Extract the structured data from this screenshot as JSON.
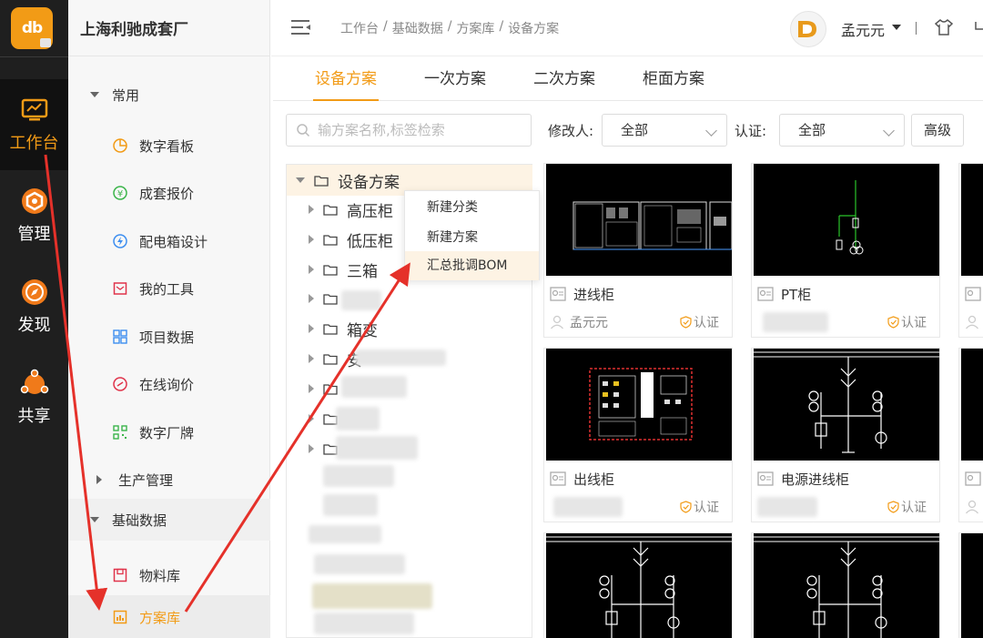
{
  "app": {
    "logo_text": "db",
    "company": "上海利驰成套厂"
  },
  "rail": [
    {
      "label": "工作台",
      "icon": "monitor-icon",
      "active": true
    },
    {
      "label": "管理",
      "icon": "hexagon-gear-icon"
    },
    {
      "label": "发现",
      "icon": "compass-icon"
    },
    {
      "label": "共享",
      "icon": "share-icon"
    }
  ],
  "sidebar": {
    "groups": {
      "common": "常用",
      "production": "生产管理",
      "basic_data": "基础数据"
    },
    "common_items": [
      {
        "label": "数字看板",
        "icon": "pie-chart-icon"
      },
      {
        "label": "成套报价",
        "icon": "yen-icon"
      },
      {
        "label": "配电箱设计",
        "icon": "lightning-icon"
      },
      {
        "label": "我的工具",
        "icon": "toolbox-icon"
      },
      {
        "label": "项目数据",
        "icon": "grid-icon"
      },
      {
        "label": "在线询价",
        "icon": "link-icon"
      },
      {
        "label": "数字厂牌",
        "icon": "qr-icon"
      }
    ],
    "basic_items": [
      {
        "label": "物料库",
        "icon": "box-icon"
      },
      {
        "label": "方案库",
        "icon": "bar-chart-icon",
        "active": true
      }
    ]
  },
  "topbar": {
    "breadcrumb": [
      "工作台",
      "基础数据",
      "方案库",
      "设备方案"
    ],
    "username": "孟元元"
  },
  "tabs": [
    "设备方案",
    "一次方案",
    "二次方案",
    "柜面方案"
  ],
  "filters": {
    "search_placeholder": "输方案名称,标签检索",
    "modifier_label": "修改人:",
    "modifier_value": "全部",
    "cert_label": "认证:",
    "cert_value": "全部",
    "advanced": "高级"
  },
  "tree": {
    "root": "设备方案",
    "children": [
      "高压柜",
      "低压柜",
      "三箱",
      "",
      "箱变",
      "安"
    ]
  },
  "context_menu": [
    "新建分类",
    "新建方案",
    "汇总批调BOM"
  ],
  "cards": [
    {
      "name": "进线柜",
      "user": "孟元元",
      "cert": "认证"
    },
    {
      "name": "PT柜",
      "user": "",
      "cert": "认证"
    },
    {
      "name": "出线柜",
      "user": "",
      "cert": "认证"
    },
    {
      "name": "电源进线柜",
      "user": "",
      "cert": "认证"
    },
    {
      "name": "",
      "user": "",
      "cert": ""
    },
    {
      "name": "",
      "user": "",
      "cert": ""
    }
  ],
  "colors": {
    "accent": "#f29b16",
    "rail_bg": "#1f1f1f",
    "annotation_red": "#e5312a"
  }
}
